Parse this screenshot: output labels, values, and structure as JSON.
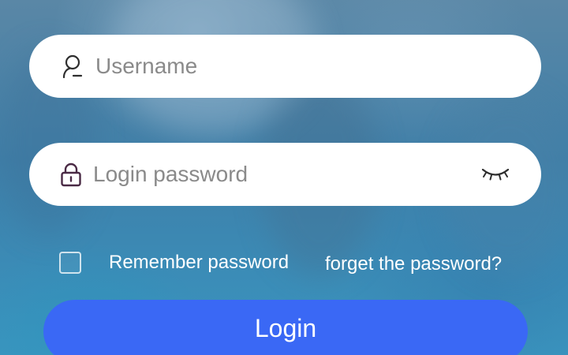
{
  "login_form": {
    "username": {
      "placeholder": "Username",
      "value": "",
      "icon": "user-icon"
    },
    "password": {
      "placeholder": "Login password",
      "value": "",
      "icon": "lock-icon",
      "toggle_icon": "eye-closed-icon"
    },
    "remember": {
      "label": "Remember password",
      "checked": false
    },
    "forget_link": "forget the password?",
    "login_label": "Login"
  },
  "colors": {
    "field_background": "#ffffff",
    "placeholder_text": "#8a8a8a",
    "button_accent": "#3a68f5",
    "icon_stroke": "#2e2e2e",
    "lock_icon": "#4a2a45",
    "background": "#3e7ea6"
  }
}
